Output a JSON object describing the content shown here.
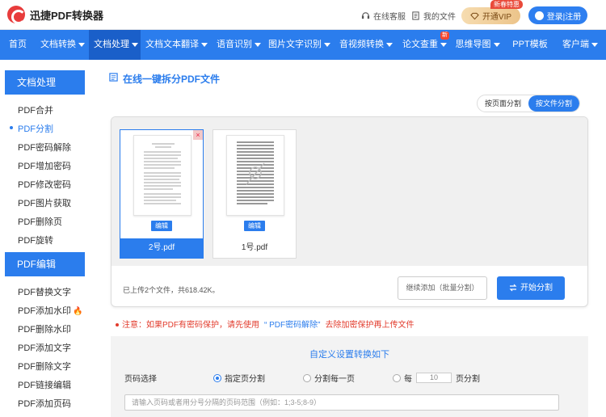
{
  "header": {
    "logo_text": "迅捷PDF转换器",
    "service_label": "在线客服",
    "files_label": "我的文件",
    "vip_label": "开通VIP",
    "vip_badge": "新春特惠",
    "login_label": "登录|注册"
  },
  "nav": {
    "items": [
      {
        "label": "首页",
        "caret": false
      },
      {
        "label": "文档转换",
        "caret": true
      },
      {
        "label": "文档处理",
        "caret": true,
        "active": true
      },
      {
        "label": "文档文本翻译",
        "caret": true
      },
      {
        "label": "语音识别",
        "caret": true
      },
      {
        "label": "图片文字识别",
        "caret": true
      },
      {
        "label": "音视频转换",
        "caret": true
      },
      {
        "label": "论文查重",
        "caret": true,
        "badge": "新"
      },
      {
        "label": "思维导图",
        "caret": true
      },
      {
        "label": "PPT模板",
        "caret": false
      },
      {
        "label": "客户端",
        "caret": true
      }
    ]
  },
  "sidebar": {
    "section1_title": "文档处理",
    "section1_items": [
      "PDF合并",
      "PDF分割",
      "PDF密码解除",
      "PDF增加密码",
      "PDF修改密码",
      "PDF图片获取",
      "PDF删除页",
      "PDF旋转"
    ],
    "section2_title": "PDF编辑",
    "section2_items": [
      "PDF替换文字",
      "PDF添加水印",
      "PDF删除水印",
      "PDF添加文字",
      "PDF删除文字",
      "PDF链接编辑",
      "PDF添加页码"
    ]
  },
  "main": {
    "title": "在线一键拆分PDF文件",
    "mode_page": "按页面分割",
    "mode_file": "按文件分割",
    "files": [
      {
        "name": "2号.pdf",
        "edit": "编辑"
      },
      {
        "name": "1号.pdf",
        "edit": "编辑"
      }
    ],
    "upload_status": "已上传2个文件，共618.42K。",
    "continue_btn": "继续添加（批量分割）",
    "split_btn": "开始分割",
    "notice_prefix": "注意：如果PDF有密码保护，请先使用",
    "notice_link": "“ PDF密码解除”",
    "notice_suffix": "去除加密保护再上传文件",
    "settings_title": "自定义设置转换如下",
    "page_select_label": "页码选择",
    "opt_specified": "指定页分割",
    "opt_each": "分割每一页",
    "opt_every_prefix": "每",
    "opt_every_value": "10",
    "opt_every_suffix": "页分割",
    "range_placeholder": "请输入页码或者用分号分隔的页码范围（例如：1;3-5;8-9）"
  }
}
